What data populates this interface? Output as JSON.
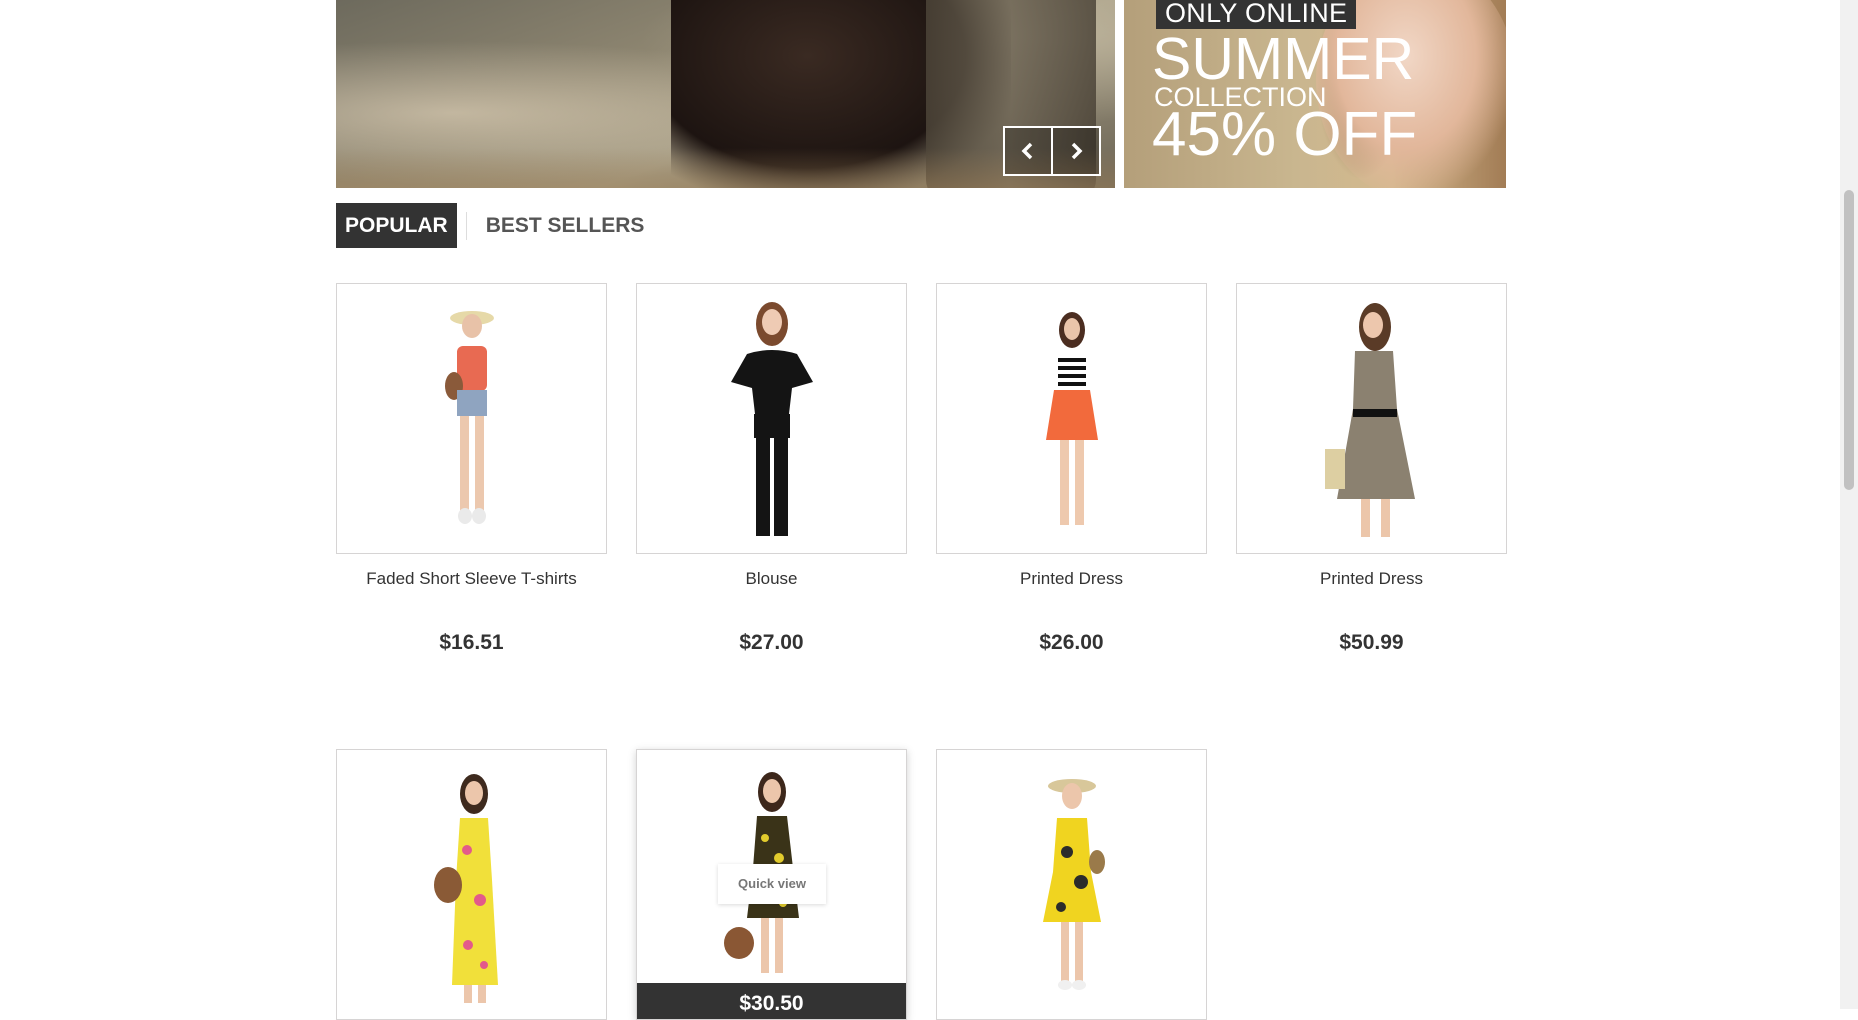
{
  "slider": {
    "prev_icon": "chevron-left-icon",
    "next_icon": "chevron-right-icon"
  },
  "promo": {
    "badge": "ONLY ONLINE",
    "headline": "SUMMER",
    "subline": "COLLECTION",
    "discount": "45% OFF"
  },
  "tabs": [
    {
      "label": "POPULAR",
      "active": true
    },
    {
      "label": "BEST SELLERS",
      "active": false
    }
  ],
  "products": [
    {
      "name": "Faded Short Sleeve T-shirts",
      "price": "$16.51"
    },
    {
      "name": "Blouse",
      "price": "$27.00"
    },
    {
      "name": "Printed Dress",
      "price": "$26.00"
    },
    {
      "name": "Printed Dress",
      "price": "$50.99"
    },
    {
      "name": "",
      "price": ""
    },
    {
      "name": "",
      "price": "$30.50",
      "quick_view": "Quick view"
    },
    {
      "name": "",
      "price": ""
    }
  ],
  "colors": {
    "dark": "#333333",
    "border": "#d6d4d4"
  }
}
